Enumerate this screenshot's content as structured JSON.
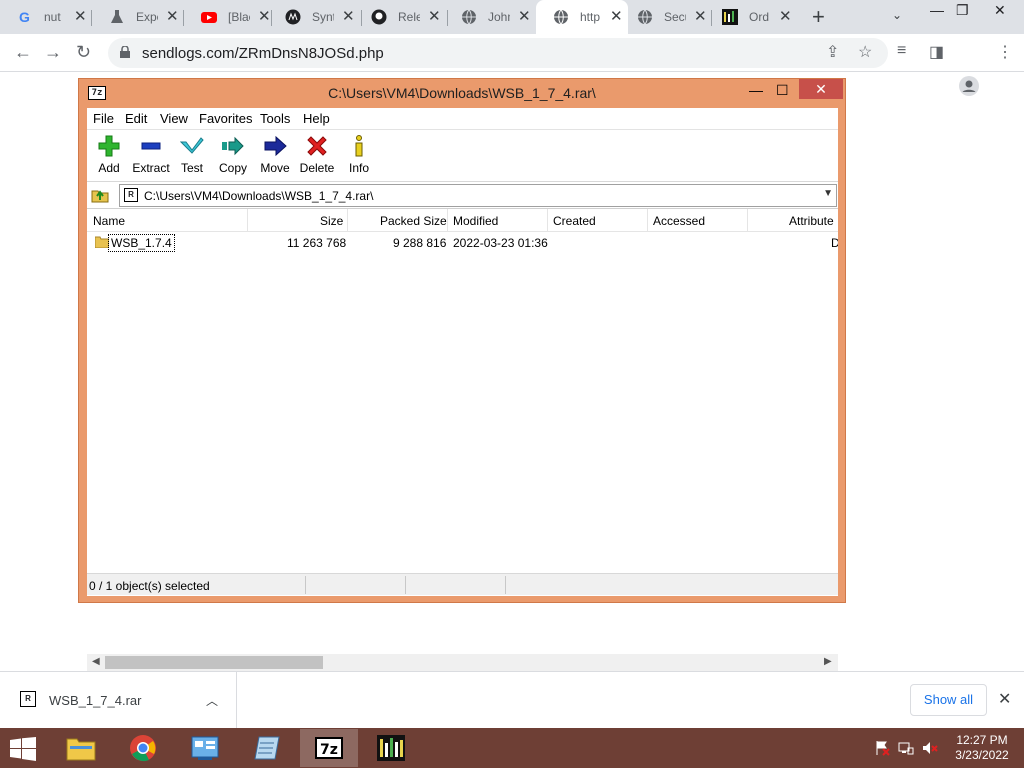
{
  "browser": {
    "tabs": [
      {
        "title": "nut",
        "icon": "google-icon"
      },
      {
        "title": "Expe",
        "icon": "flask-icon"
      },
      {
        "title": "[Blac",
        "icon": "youtube-icon"
      },
      {
        "title": "Synt",
        "icon": "synthwave-icon"
      },
      {
        "title": "Rele",
        "icon": "github-icon"
      },
      {
        "title": "John",
        "icon": "globe-icon"
      },
      {
        "title": "http",
        "icon": "globe-icon",
        "active": true
      },
      {
        "title": "Secu",
        "icon": "globe-icon"
      },
      {
        "title": "Ord",
        "icon": "app-icon"
      }
    ],
    "url": "sendlogs.com/ZRmDnsN8JOSd.php"
  },
  "sevenzip": {
    "title": "C:\\Users\\VM4\\Downloads\\WSB_1_7_4.rar\\",
    "menu": [
      "File",
      "Edit",
      "View",
      "Favorites",
      "Tools",
      "Help"
    ],
    "toolbar": {
      "add": "Add",
      "extract": "Extract",
      "test": "Test",
      "copy": "Copy",
      "move": "Move",
      "delete": "Delete",
      "info": "Info"
    },
    "address": "C:\\Users\\VM4\\Downloads\\WSB_1_7_4.rar\\",
    "columns": {
      "name": "Name",
      "size": "Size",
      "packed": "Packed Size",
      "modified": "Modified",
      "created": "Created",
      "accessed": "Accessed",
      "attributes": "Attribute"
    },
    "rows": [
      {
        "name": "WSB_1.7.4",
        "size": "11 263 768",
        "packed": "9 288 816",
        "modified": "2022-03-23 01:36",
        "attributes": "D"
      }
    ],
    "status": "0 / 1 object(s) selected",
    "colors": {
      "frame": "#ea9a6c",
      "close": "#c7504a"
    }
  },
  "downloads": {
    "file": "WSB_1_7_4.rar",
    "show_all": "Show all"
  },
  "taskbar": {
    "time": "12:27 PM",
    "date": "3/23/2022",
    "color": "#6e3f35"
  }
}
